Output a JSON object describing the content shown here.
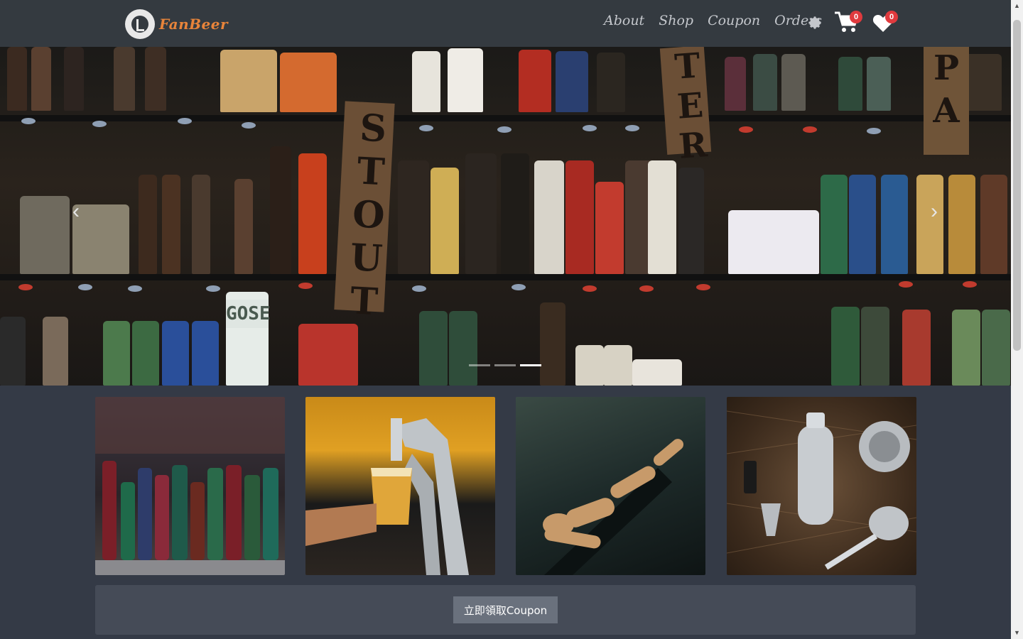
{
  "brand": {
    "name": "FanBeer",
    "logo_icon": "beer-logo-icon"
  },
  "nav": {
    "links": [
      "About",
      "Shop",
      "Coupon",
      "Orders"
    ],
    "settings_icon": "gear-icon",
    "cart": {
      "icon": "cart-icon",
      "count": "0"
    },
    "wishlist": {
      "icon": "heart-icon",
      "count": "0"
    }
  },
  "carousel": {
    "slide_count": 3,
    "active_index": 2,
    "prev_icon": "chevron-left-icon",
    "next_icon": "chevron-right-icon",
    "signs": {
      "stout": "STOUT",
      "gose": "GOSE",
      "ter": "TER"
    }
  },
  "cards": [
    {
      "name": "beer-bottles-card"
    },
    {
      "name": "beer-tap-card"
    },
    {
      "name": "wooden-mannequin-card"
    },
    {
      "name": "cocktail-tools-card"
    }
  ],
  "coupon": {
    "button_label": "立即領取Coupon"
  },
  "colors": {
    "navbar": "#343a40",
    "background": "#343a46",
    "accent": "#e8843a",
    "badge": "#e03a3e"
  }
}
